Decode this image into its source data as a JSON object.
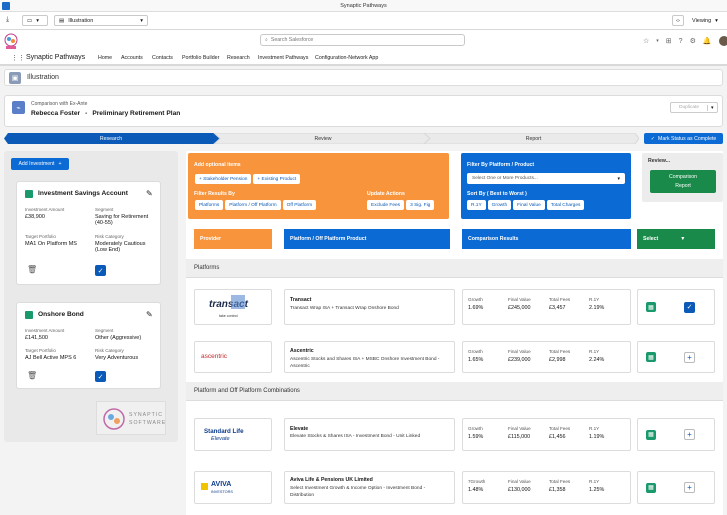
{
  "app_title": "Synaptic Pathways",
  "tab": {
    "label": "Illustration",
    "viewing": "Viewing"
  },
  "global": {
    "search_placeholder": "Search Salesforce"
  },
  "nav": {
    "app_name": "Synaptic Pathways",
    "items": [
      "Home",
      "Accounts",
      "Contacts",
      "Portfolio Builder",
      "Research",
      "Investment Pathways",
      "Configuration-Network App"
    ]
  },
  "record": {
    "object_label": "Illustration"
  },
  "illustration": {
    "subtitle": "Comparison with Ex-Ante",
    "client": "Rebecca Foster",
    "plan": "Preliminary Retirement Plan",
    "duplicate_label": "Duplicate"
  },
  "path": {
    "steps": [
      "Research",
      "Review",
      "Report"
    ],
    "complete_button": "Mark Status as Complete"
  },
  "left": {
    "add_button": "Add Investment",
    "accounts": [
      {
        "name": "Investment Savings Account",
        "amount_label": "Investment Amount",
        "amount": "£38,900",
        "segment_label": "Segment",
        "segment": "Saving for Retirement (40-55)",
        "portfolio_label": "Target Portfolio",
        "portfolio": "MA1 On Platform MS",
        "risk_label": "Risk Category",
        "risk": "Moderately Cautious (Low End)"
      },
      {
        "name": "Onshore Bond",
        "amount_label": "Investment Amount",
        "amount": "£141,500",
        "segment_label": "Segment",
        "segment": "Other (Aggressive)",
        "portfolio_label": "Target Portfolio",
        "portfolio": "AJ Bell Active MPS 6",
        "risk_label": "Risk Category",
        "risk": "Very Adventurous"
      }
    ],
    "logo_text": {
      "line1": "SYNAPTIC",
      "line2": "SOFTWARE"
    }
  },
  "filters": {
    "add_items_label": "Add optional items",
    "add_items_buttons": [
      "+ Stakeholder Pension",
      "+ Existing Product"
    ],
    "filter_results_label": "Filter Results By",
    "filter_results_buttons": [
      "Platforms",
      "Platform / Off Platform",
      "Off Platform"
    ],
    "update_label": "Update Actions",
    "update_buttons": [
      "Exclude Fees",
      "3 Sig. Fig"
    ],
    "platform_label": "Filter By Platform / Product",
    "platform_select": "Select One or More Products...",
    "sort_label": "Sort By ( Best to Worst )",
    "sort_buttons": [
      "R.1Y",
      "Growth",
      "Final Value",
      "Total Charges"
    ],
    "review_label": "Review...",
    "comparison_button": {
      "line1": "Comparison",
      "line2": "Report"
    }
  },
  "columns": {
    "provider": "Provider",
    "product": "Platform / Off Platform Product",
    "results": "Comparison Results",
    "select": "Select"
  },
  "sections": {
    "platforms": "Platforms",
    "combinations": "Platform and Off Platform Combinations"
  },
  "results": [
    {
      "logo": "transact",
      "logo_sub": "take control",
      "name": "Transact",
      "desc": "Transact Wrap ISA + Transact Wrap Onshore Bond",
      "growth_label": "Growth",
      "growth": "1.69%",
      "fv_label": "Final Value",
      "fv": "£245,000",
      "fees_label": "Total Fees",
      "fees": "£3,457",
      "r_label": "R.1Y",
      "r": "2.19%",
      "selected": true
    },
    {
      "logo": "ascentric",
      "logo_sub": "",
      "name": "Ascentric",
      "desc": "Ascentric Stocks and Shares ISA + MSBC Onshore Investment Bond - Ascentric",
      "growth_label": "Growth",
      "growth": "1.65%",
      "fv_label": "Final Value",
      "fv": "£239,000",
      "fees_label": "Total Fees",
      "fees": "£2,998",
      "r_label": "R.1Y",
      "r": "2.24%",
      "selected": false
    },
    {
      "logo": "Standard Life",
      "logo_sub": "Elevate",
      "name": "Elevate",
      "desc": "Elevate Stocks & Shares ISA - Investment Bond - Unit Linked",
      "growth_label": "Growth",
      "growth": "1.59%",
      "fv_label": "Final Value",
      "fv": "£115,000",
      "fees_label": "Total Fees",
      "fees": "£1,456",
      "r_label": "R.1Y",
      "r": "1.19%",
      "selected": false
    },
    {
      "logo": "AVIVA",
      "logo_sub": "INVESTORS",
      "name": "Aviva Life & Pensions UK Limited",
      "desc": "Select Investment Growth & Income Option - Investment Bond - Distribution",
      "growth_label": "7Growth",
      "growth": "1.48%",
      "fv_label": "Final Value",
      "fv": "£130,000",
      "fees_label": "Total Fees",
      "fees": "£1,358",
      "r_label": "R.1Y",
      "r": "1.25%",
      "selected": false
    }
  ],
  "colors": {
    "brand_blue": "#0b6ad4",
    "orange": "#f7943c",
    "green": "#1a8a4a"
  }
}
